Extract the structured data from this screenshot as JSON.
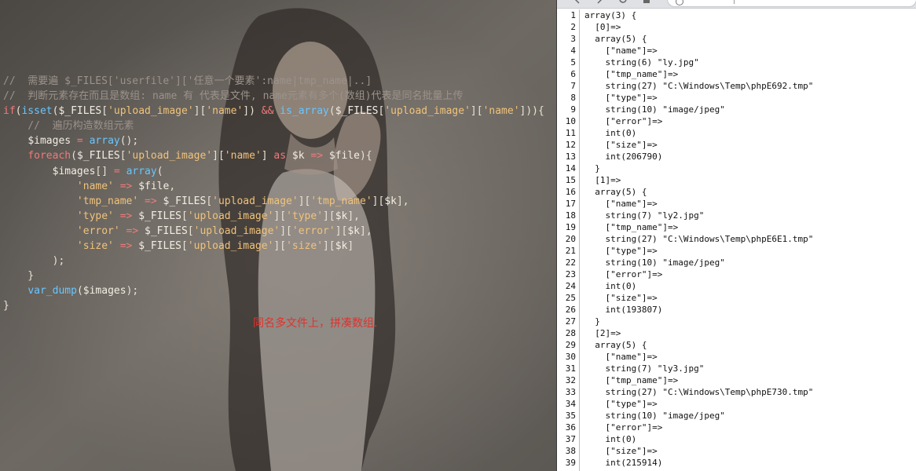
{
  "editor": {
    "caption": "同名多文件上，拼凑数组.",
    "lines": [
      [
        {
          "t": "//  需要遍 $_FILES['userfile']['任意一个要素':name|tmp_name|..]",
          "c": "comment"
        }
      ],
      [
        {
          "t": "//  判断元素存在而且是数组: name 有 代表是文件, name元素有多个(数组)代表是同名批量上传",
          "c": "comment"
        }
      ],
      [
        {
          "t": "if",
          "c": "keyword"
        },
        {
          "t": "(",
          "c": "plain"
        },
        {
          "t": "isset",
          "c": "func"
        },
        {
          "t": "(",
          "c": "plain"
        },
        {
          "t": "$_FILES",
          "c": "var"
        },
        {
          "t": "[",
          "c": "plain"
        },
        {
          "t": "'upload_image'",
          "c": "string"
        },
        {
          "t": "][",
          "c": "plain"
        },
        {
          "t": "'name'",
          "c": "string"
        },
        {
          "t": "]) ",
          "c": "plain"
        },
        {
          "t": "&&",
          "c": "op"
        },
        {
          "t": " ",
          "c": "plain"
        },
        {
          "t": "is_array",
          "c": "func"
        },
        {
          "t": "(",
          "c": "plain"
        },
        {
          "t": "$_FILES",
          "c": "var"
        },
        {
          "t": "[",
          "c": "plain"
        },
        {
          "t": "'upload_image'",
          "c": "string"
        },
        {
          "t": "][",
          "c": "plain"
        },
        {
          "t": "'name'",
          "c": "string"
        },
        {
          "t": "])){",
          "c": "plain"
        }
      ],
      [
        {
          "t": "    //  遍历构造数组元素",
          "c": "comment"
        }
      ],
      [
        {
          "t": "    ",
          "c": "plain"
        },
        {
          "t": "$images",
          "c": "var"
        },
        {
          "t": " = ",
          "c": "op"
        },
        {
          "t": "array",
          "c": "func"
        },
        {
          "t": "();",
          "c": "plain"
        }
      ],
      [
        {
          "t": "    ",
          "c": "plain"
        },
        {
          "t": "foreach",
          "c": "keyword"
        },
        {
          "t": "(",
          "c": "plain"
        },
        {
          "t": "$_FILES",
          "c": "var"
        },
        {
          "t": "[",
          "c": "plain"
        },
        {
          "t": "'upload_image'",
          "c": "string"
        },
        {
          "t": "][",
          "c": "plain"
        },
        {
          "t": "'name'",
          "c": "string"
        },
        {
          "t": "] ",
          "c": "plain"
        },
        {
          "t": "as",
          "c": "keyword"
        },
        {
          "t": " ",
          "c": "plain"
        },
        {
          "t": "$k",
          "c": "var"
        },
        {
          "t": " => ",
          "c": "op"
        },
        {
          "t": "$file",
          "c": "var"
        },
        {
          "t": "){",
          "c": "plain"
        }
      ],
      [
        {
          "t": "        ",
          "c": "plain"
        },
        {
          "t": "$images",
          "c": "var"
        },
        {
          "t": "[] ",
          "c": "plain"
        },
        {
          "t": "=",
          "c": "op"
        },
        {
          "t": " ",
          "c": "plain"
        },
        {
          "t": "array",
          "c": "func"
        },
        {
          "t": "(",
          "c": "plain"
        }
      ],
      [
        {
          "t": "            ",
          "c": "plain"
        },
        {
          "t": "'name'",
          "c": "string"
        },
        {
          "t": " => ",
          "c": "op"
        },
        {
          "t": "$file",
          "c": "var"
        },
        {
          "t": ",",
          "c": "plain"
        }
      ],
      [
        {
          "t": "            ",
          "c": "plain"
        },
        {
          "t": "'tmp_name'",
          "c": "string"
        },
        {
          "t": " => ",
          "c": "op"
        },
        {
          "t": "$_FILES",
          "c": "var"
        },
        {
          "t": "[",
          "c": "plain"
        },
        {
          "t": "'upload_image'",
          "c": "string"
        },
        {
          "t": "][",
          "c": "plain"
        },
        {
          "t": "'tmp_name'",
          "c": "string"
        },
        {
          "t": "][",
          "c": "plain"
        },
        {
          "t": "$k",
          "c": "var"
        },
        {
          "t": "],",
          "c": "plain"
        }
      ],
      [
        {
          "t": "            ",
          "c": "plain"
        },
        {
          "t": "'type'",
          "c": "string"
        },
        {
          "t": " => ",
          "c": "op"
        },
        {
          "t": "$_FILES",
          "c": "var"
        },
        {
          "t": "[",
          "c": "plain"
        },
        {
          "t": "'upload_image'",
          "c": "string"
        },
        {
          "t": "][",
          "c": "plain"
        },
        {
          "t": "'type'",
          "c": "string"
        },
        {
          "t": "][",
          "c": "plain"
        },
        {
          "t": "$k",
          "c": "var"
        },
        {
          "t": "],",
          "c": "plain"
        }
      ],
      [
        {
          "t": "            ",
          "c": "plain"
        },
        {
          "t": "'error'",
          "c": "string"
        },
        {
          "t": " => ",
          "c": "op"
        },
        {
          "t": "$_FILES",
          "c": "var"
        },
        {
          "t": "[",
          "c": "plain"
        },
        {
          "t": "'upload_image'",
          "c": "string"
        },
        {
          "t": "][",
          "c": "plain"
        },
        {
          "t": "'error'",
          "c": "string"
        },
        {
          "t": "][",
          "c": "plain"
        },
        {
          "t": "$k",
          "c": "var"
        },
        {
          "t": "],",
          "c": "plain"
        }
      ],
      [
        {
          "t": "            ",
          "c": "plain"
        },
        {
          "t": "'size'",
          "c": "string"
        },
        {
          "t": " => ",
          "c": "op"
        },
        {
          "t": "$_FILES",
          "c": "var"
        },
        {
          "t": "[",
          "c": "plain"
        },
        {
          "t": "'upload_image'",
          "c": "string"
        },
        {
          "t": "][",
          "c": "plain"
        },
        {
          "t": "'size'",
          "c": "string"
        },
        {
          "t": "][",
          "c": "plain"
        },
        {
          "t": "$k",
          "c": "var"
        },
        {
          "t": "]",
          "c": "plain"
        }
      ],
      [
        {
          "t": "        );",
          "c": "plain"
        }
      ],
      [
        {
          "t": "    }",
          "c": "plain"
        }
      ],
      [
        {
          "t": "    ",
          "c": "plain"
        },
        {
          "t": "var_dump",
          "c": "func"
        },
        {
          "t": "(",
          "c": "plain"
        },
        {
          "t": "$images",
          "c": "var"
        },
        {
          "t": ");",
          "c": "plain"
        }
      ],
      [
        {
          "t": "}",
          "c": "plain"
        }
      ]
    ]
  },
  "output": {
    "lines": [
      "array(3) {",
      "  [0]=>",
      "  array(5) {",
      "    [\"name\"]=>",
      "    string(6) \"ly.jpg\"",
      "    [\"tmp_name\"]=>",
      "    string(27) \"C:\\Windows\\Temp\\phpE692.tmp\"",
      "    [\"type\"]=>",
      "    string(10) \"image/jpeg\"",
      "    [\"error\"]=>",
      "    int(0)",
      "    [\"size\"]=>",
      "    int(206790)",
      "  }",
      "  [1]=>",
      "  array(5) {",
      "    [\"name\"]=>",
      "    string(7) \"ly2.jpg\"",
      "    [\"tmp_name\"]=>",
      "    string(27) \"C:\\Windows\\Temp\\phpE6E1.tmp\"",
      "    [\"type\"]=>",
      "    string(10) \"image/jpeg\"",
      "    [\"error\"]=>",
      "    int(0)",
      "    [\"size\"]=>",
      "    int(193807)",
      "  }",
      "  [2]=>",
      "  array(5) {",
      "    [\"name\"]=>",
      "    string(7) \"ly3.jpg\"",
      "    [\"tmp_name\"]=>",
      "    string(27) \"C:\\Windows\\Temp\\phpE730.tmp\"",
      "    [\"type\"]=>",
      "    string(10) \"image/jpeg\"",
      "    [\"error\"]=>",
      "    int(0)",
      "    [\"size\"]=>",
      "    int(215914)"
    ]
  }
}
